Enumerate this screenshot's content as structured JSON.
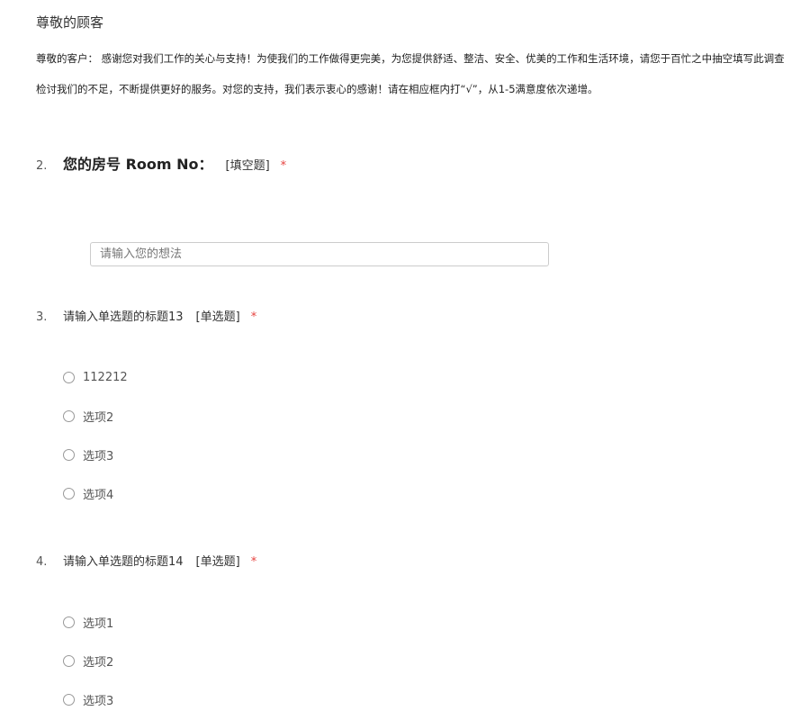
{
  "survey": {
    "title": "尊敬的顾客",
    "intro_line1": "尊敬的客户： 感谢您对我们工作的关心与支持！为使我们的工作做得更完美，为您提供舒适、整洁、安全、优美的工作和生活环境，请您于百忙之中抽空填写此调查",
    "intro_line2": "检讨我们的不足，不断提供更好的服务。对您的支持，我们表示衷心的感谢！请在相应框内打“√”，从1-5满意度依次递增。"
  },
  "questions": [
    {
      "number": "2.",
      "title": "您的房号 Room No：",
      "type": "[填空题]",
      "required": "*",
      "placeholder": "请输入您的想法"
    },
    {
      "number": "3.",
      "title": "请输入单选题的标题13",
      "type": "[单选题]",
      "required": "*",
      "options": [
        "112212",
        "选项2",
        "选项3",
        "选项4"
      ]
    },
    {
      "number": "4.",
      "title": "请输入单选题的标题14",
      "type": "[单选题]",
      "required": "*",
      "options": [
        "选项1",
        "选项2",
        "选项3"
      ]
    }
  ],
  "colors": {
    "required": "#e64340",
    "border": "#cccccc",
    "radio_border": "#999999"
  }
}
